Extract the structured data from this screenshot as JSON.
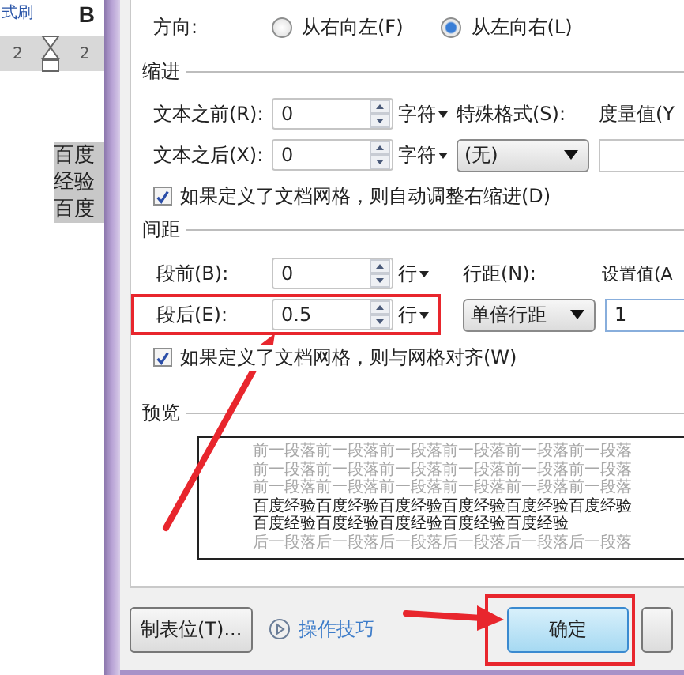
{
  "document": {
    "ribbon_text": "式刷",
    "bold_button": "B",
    "ruler_marks": [
      "2",
      "2"
    ],
    "text_lines": [
      "百度",
      "经验",
      "百度"
    ]
  },
  "dialog": {
    "direction": {
      "label": "方向:",
      "options": [
        {
          "label": "从右向左(F)",
          "selected": false
        },
        {
          "label": "从左向右(L)",
          "selected": true
        }
      ]
    },
    "indent": {
      "title": "缩进",
      "rows": [
        {
          "label": "文本之前(R):",
          "value": "0",
          "unit": "字符"
        },
        {
          "label": "文本之后(X):",
          "value": "0",
          "unit": "字符"
        }
      ],
      "special_label": "特殊格式(S):",
      "special_value": "(无)",
      "amount_label": "度量值(Y",
      "checkbox": {
        "label": "如果定义了文档网格，则自动调整右缩进(D)",
        "checked": true
      }
    },
    "spacing": {
      "title": "间距",
      "rows": [
        {
          "label": "段前(B):",
          "value": "0",
          "unit": "行",
          "highlighted": false
        },
        {
          "label": "段后(E):",
          "value": "0.5",
          "unit": "行",
          "highlighted": true
        }
      ],
      "line_spacing_label": "行距(N):",
      "line_spacing_value": "单倍行距",
      "set_value_label": "设置值(A",
      "set_value": "1",
      "checkbox": {
        "label": "如果定义了文档网格，则与网格对齐(W)",
        "checked": true
      }
    },
    "preview": {
      "title": "预览",
      "previous_lines": [
        "前一段落前一段落前一段落前一段落前一段落前一段落",
        "前一段落前一段落前一段落前一段落前一段落前一段落",
        "前一段落前一段落前一段落前一段落前一段落前一段落"
      ],
      "current_lines": [
        "百度经验百度经验百度经验百度经验百度经验百度经验",
        "百度经验百度经验百度经验百度经验百度经验"
      ],
      "next_lines": [
        "后一段落后一段落后一段落后一段落后一段落后一段落"
      ]
    },
    "buttons": {
      "tabs": "制表位(T)...",
      "tips_link": "操作技巧",
      "ok": {
        "label": "确定",
        "highlighted": true
      }
    }
  }
}
